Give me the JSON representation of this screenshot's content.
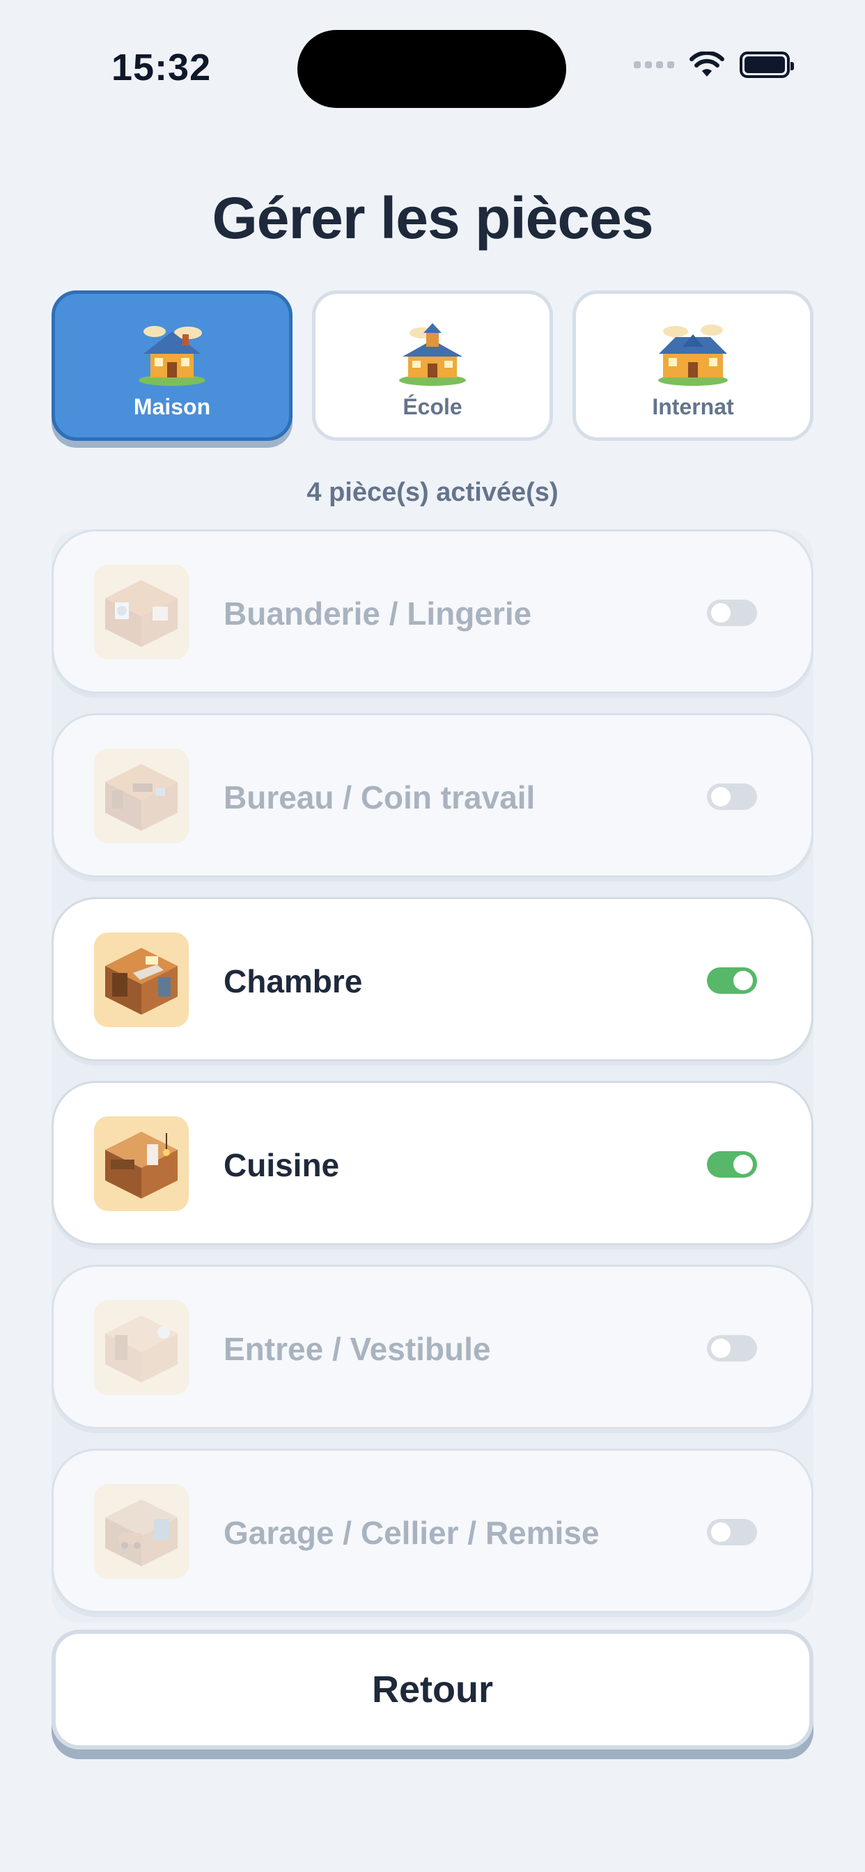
{
  "status_bar": {
    "time": "15:32"
  },
  "header": {
    "title": "Gérer les pièces"
  },
  "tabs": [
    {
      "label": "Maison",
      "active": true,
      "icon": "house-icon"
    },
    {
      "label": "École",
      "active": false,
      "icon": "school-icon"
    },
    {
      "label": "Internat",
      "active": false,
      "icon": "boarding-house-icon"
    }
  ],
  "summary": {
    "count_text": "4 pièce(s) activée(s)"
  },
  "rooms": [
    {
      "label": "Buanderie / Lingerie",
      "enabled": false,
      "icon": "laundry-room-icon"
    },
    {
      "label": "Bureau / Coin travail",
      "enabled": false,
      "icon": "office-room-icon"
    },
    {
      "label": "Chambre",
      "enabled": true,
      "icon": "bedroom-icon"
    },
    {
      "label": "Cuisine",
      "enabled": true,
      "icon": "kitchen-room-icon"
    },
    {
      "label": "Entree / Vestibule",
      "enabled": false,
      "icon": "entrance-room-icon"
    },
    {
      "label": "Garage / Cellier / Remise",
      "enabled": false,
      "icon": "garage-room-icon"
    }
  ],
  "footer": {
    "back_label": "Retour"
  },
  "colors": {
    "accent": "#4a8fd9",
    "toggle_on": "#56b868",
    "toggle_off": "#d8dde3",
    "text_dark": "#1e293b"
  }
}
